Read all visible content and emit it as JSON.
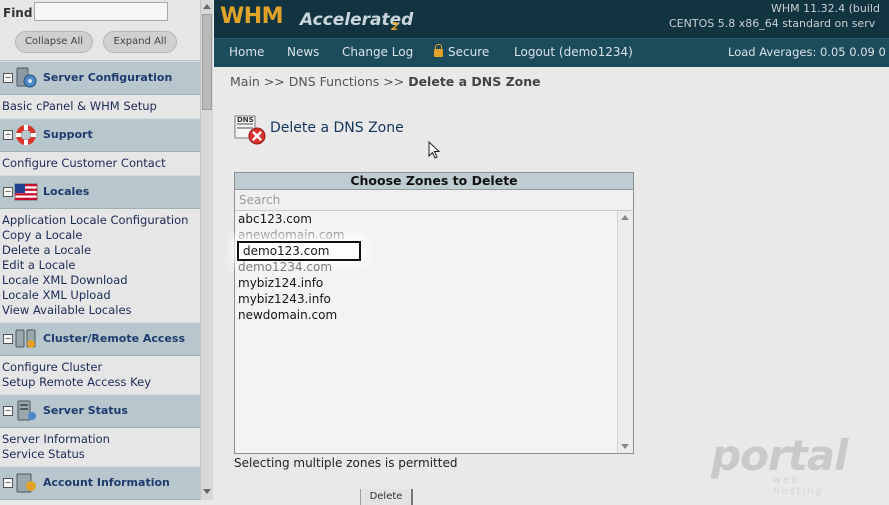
{
  "sidebar": {
    "find_label": "Find",
    "find_value": "",
    "collapse_all": "Collapse All",
    "expand_all": "Expand All",
    "sections": [
      {
        "title": "Server Configuration",
        "icon": "server-config-icon",
        "items": [
          "Basic cPanel & WHM Setup"
        ]
      },
      {
        "title": "Support",
        "icon": "lifebuoy-icon",
        "items": [
          "Configure Customer Contact"
        ]
      },
      {
        "title": "Locales",
        "icon": "flag-icon",
        "items": [
          "Application Locale Configuration",
          "Copy a Locale",
          "Delete a Locale",
          "Edit a Locale",
          "Locale XML Download",
          "Locale XML Upload",
          "View Available Locales"
        ]
      },
      {
        "title": "Cluster/Remote Access",
        "icon": "cluster-icon",
        "items": [
          "Configure Cluster",
          "Setup Remote Access Key"
        ]
      },
      {
        "title": "Server Status",
        "icon": "server-status-icon",
        "items": [
          "Server Information",
          "Service Status"
        ]
      },
      {
        "title": "Account Information",
        "icon": "account-info-icon",
        "items": []
      }
    ]
  },
  "header": {
    "logo_whm": "WHM",
    "logo_accelerated": "Accelerated",
    "logo_two": "2",
    "version_text": "WHM 11.32.4 (build",
    "os_text": "CENTOS 5.8 x86_64 standard on serv"
  },
  "nav": {
    "home": "Home",
    "news": "News",
    "change_log": "Change Log",
    "secure": "Secure",
    "logout": "Logout (demo1234)",
    "load_averages": "Load Averages: 0.05 0.09 0"
  },
  "breadcrumb": {
    "path": "Main >> DNS Functions >> ",
    "current": "Delete a DNS Zone"
  },
  "page": {
    "title": "Delete a DNS Zone",
    "icon_label": "DNS"
  },
  "zones_box": {
    "header": "Choose Zones to Delete",
    "search_placeholder": "Search",
    "zones": [
      "abc123.com",
      "anewdomain.com",
      "demo123.com",
      "demo1234.com",
      "mybiz124.info",
      "mybiz1243.info",
      "newdomain.com"
    ],
    "selected_zone": "demo123.com"
  },
  "multi_note": "Selecting multiple zones is permitted",
  "delete_button": "Delete",
  "watermark": {
    "text": "portal",
    "sub": "web hosting"
  },
  "colors": {
    "header_bg": "#123340",
    "nav_bg": "#1c4b5c",
    "accent": "#e1a229",
    "section_header_bg": "#b7c7cd"
  }
}
